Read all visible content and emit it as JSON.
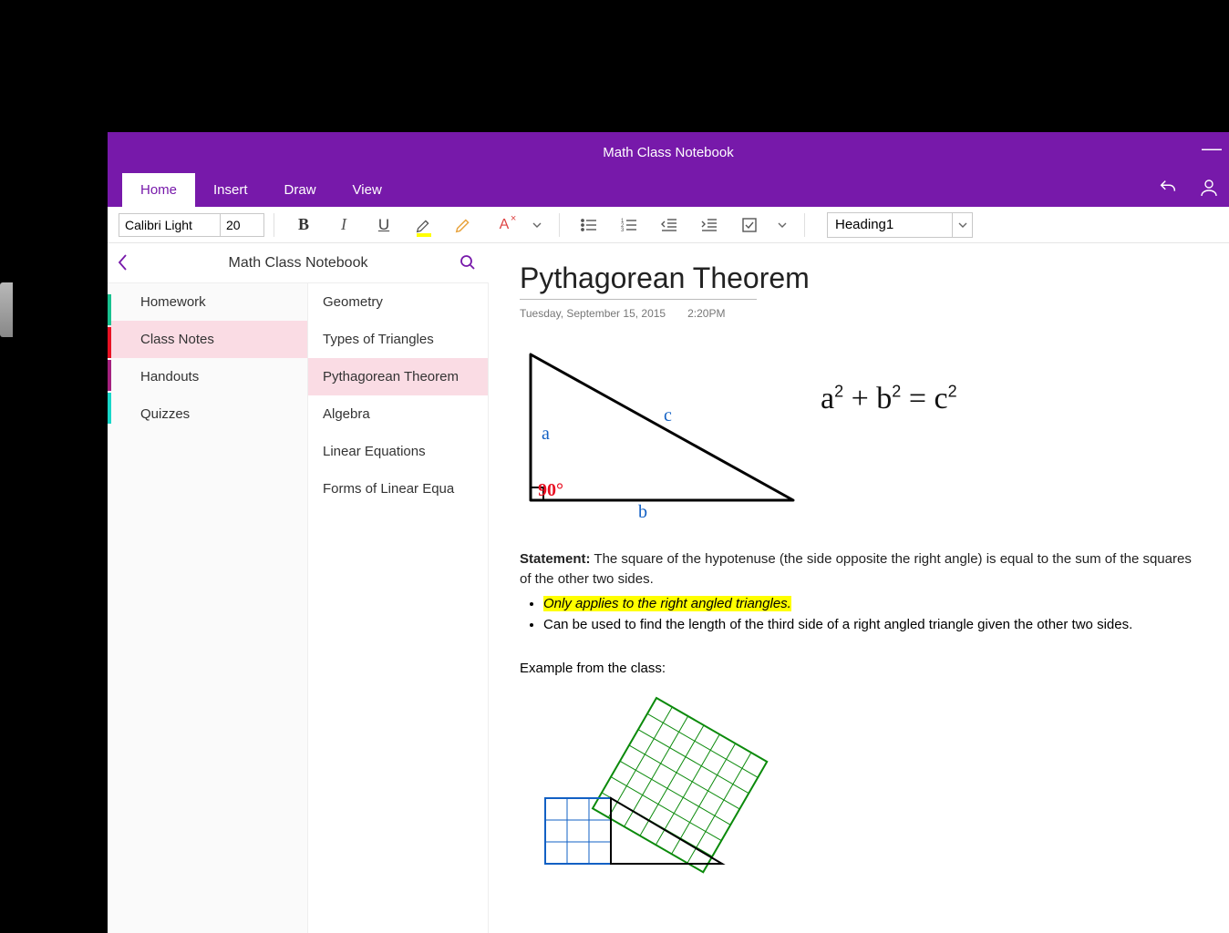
{
  "app_title": "Math Class Notebook",
  "ribbon_tabs": [
    "Home",
    "Insert",
    "Draw",
    "View"
  ],
  "active_tab": 0,
  "font": {
    "name": "Calibri Light",
    "size": "20"
  },
  "style_selector": "Heading1",
  "navigator": {
    "title": "Math Class Notebook",
    "section_colors": [
      "#18C18F",
      "#E81123",
      "#A4217F",
      "#18D7C9"
    ],
    "sections": [
      "Homework",
      "Class Notes",
      "Handouts",
      "Quizzes"
    ],
    "selected_section": 1,
    "pages": [
      "Geometry",
      "Types of Triangles",
      "Pythagorean Theorem",
      "Algebra",
      "Linear Equations",
      "Forms of Linear Equa"
    ],
    "selected_page": 2
  },
  "note": {
    "title": "Pythagorean Theorem",
    "date": "Tuesday, September 15, 2015",
    "time": "2:20PM",
    "triangle": {
      "a": "a",
      "b": "b",
      "c": "c",
      "angle": "90°"
    },
    "formula": "a² + b² = c²",
    "statement_label": "Statement:",
    "statement_text": " The square of the hypotenuse (the side opposite the right angle) is equal to the sum of the squares of the other two sides.",
    "bullet_hl": "Only applies to the right angled triangles.",
    "bullet_2": "Can be used to find the length of the third side of a right angled triangle given the other two sides.",
    "example_label": "Example from the class:"
  }
}
